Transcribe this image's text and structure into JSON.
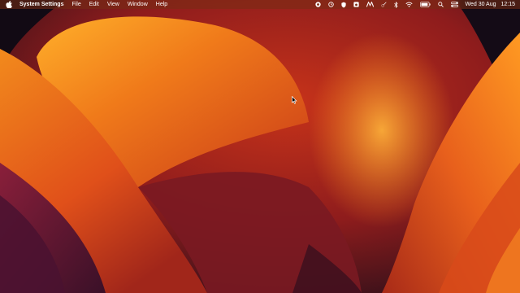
{
  "menubar": {
    "app_name": "System Settings",
    "menus": [
      "File",
      "Edit",
      "View",
      "Window",
      "Help"
    ],
    "status_icons": [
      "record-icon",
      "sync-icon",
      "shield-icon",
      "bag-icon",
      "vpn-icon",
      "search-small-icon",
      "bluetooth-icon",
      "wifi-icon",
      "battery-icon",
      "spotlight-icon",
      "control-center-icon"
    ],
    "date": "Wed 30 Aug",
    "time": "12:15"
  },
  "colors": {
    "menubar_bg": "#7a2d14",
    "wallpaper_orange": "#f28a1c",
    "wallpaper_red": "#c7331a",
    "wallpaper_dark": "#1a0d14"
  }
}
